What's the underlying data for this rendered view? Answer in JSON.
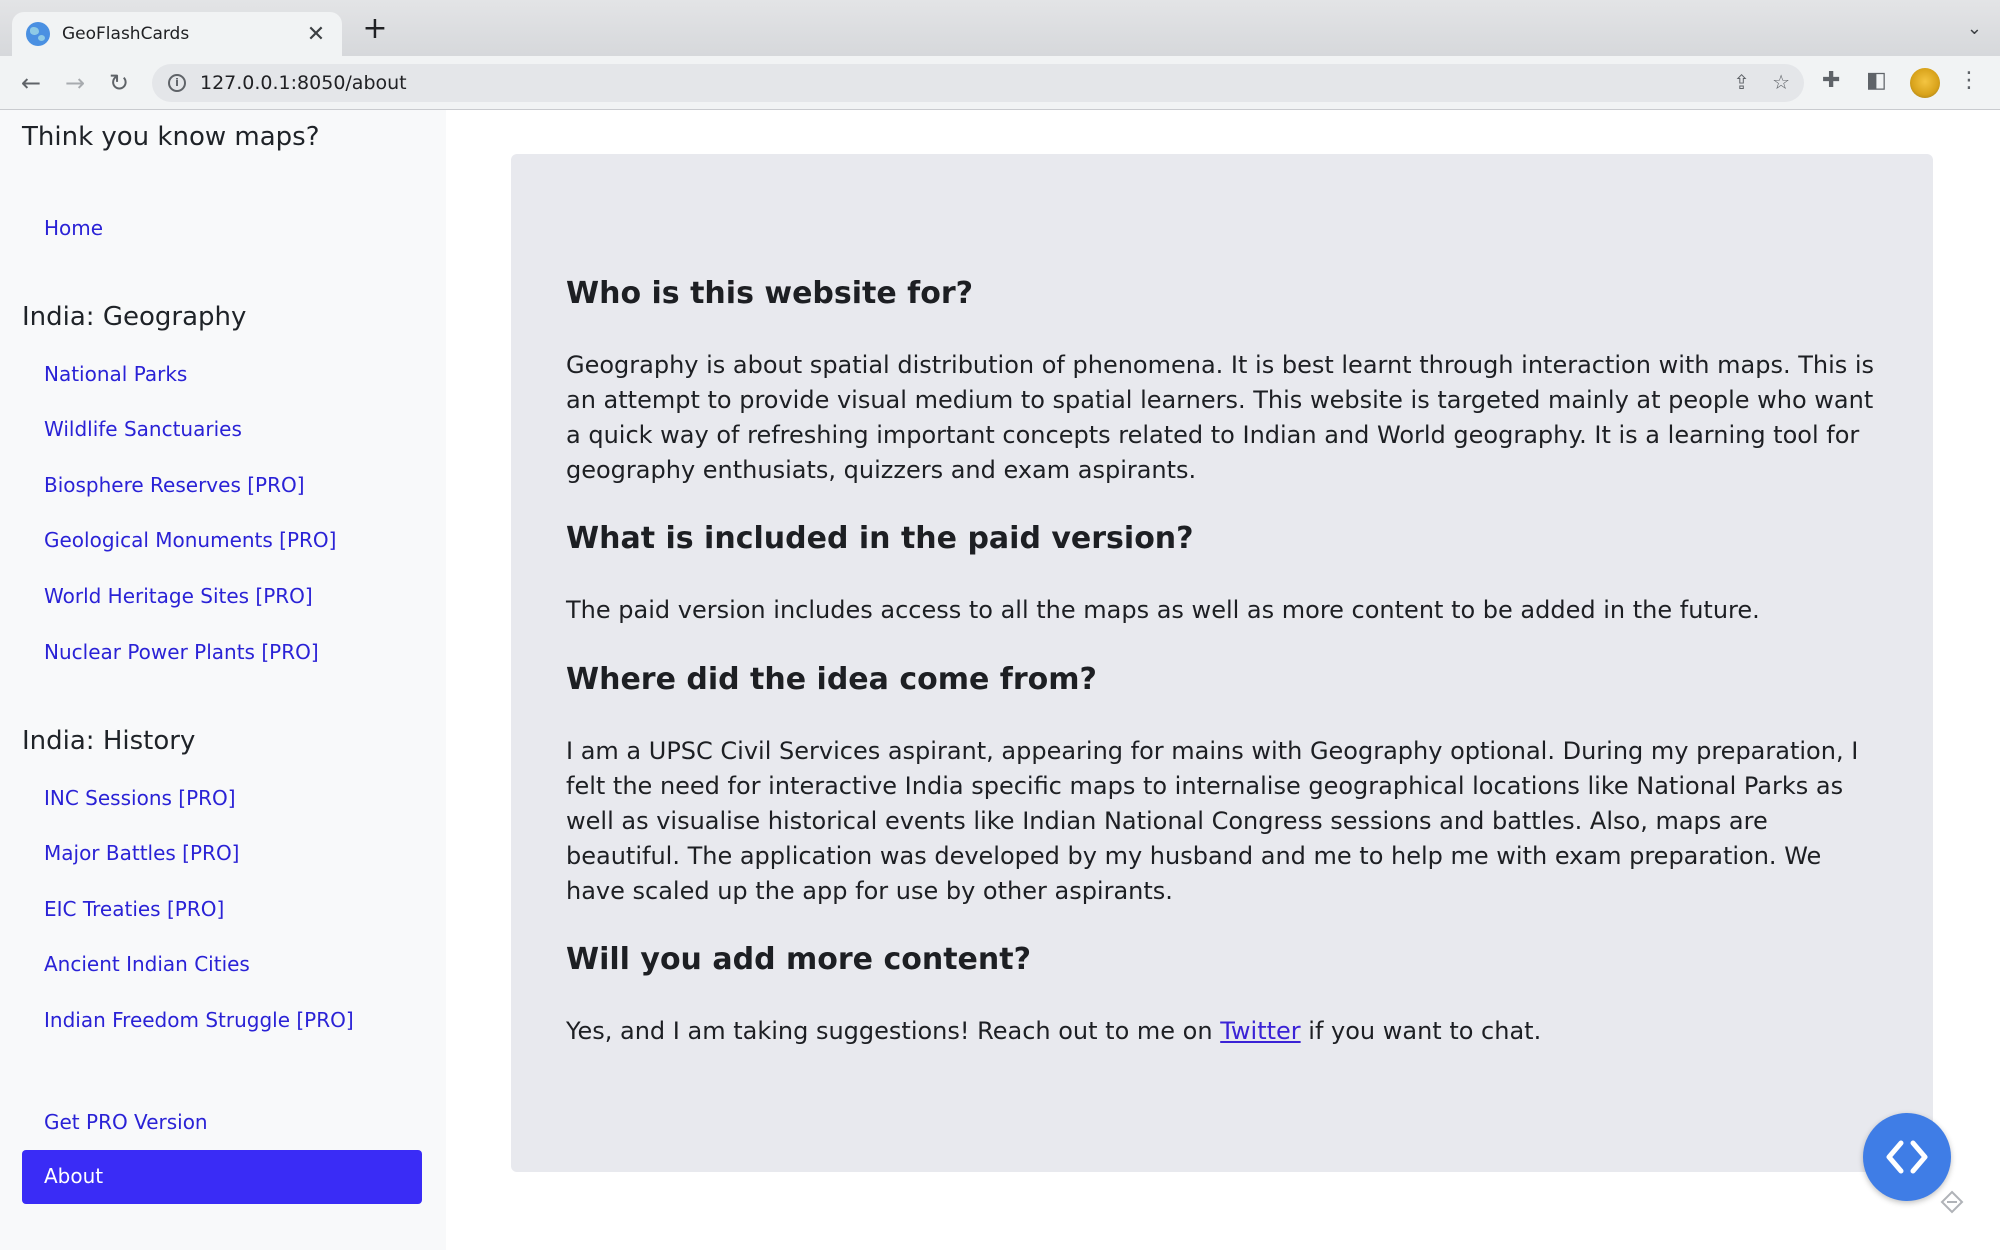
{
  "browser": {
    "tab_title": "GeoFlashCards",
    "url": "127.0.0.1:8050/about"
  },
  "sidebar": {
    "title": "Think you know maps?",
    "home": "Home",
    "sections": [
      {
        "heading": "India: Geography",
        "items": [
          "National Parks",
          "Wildlife Sanctuaries",
          "Biosphere Reserves [PRO]",
          "Geological Monuments [PRO]",
          "World Heritage Sites [PRO]",
          "Nuclear Power Plants [PRO]"
        ]
      },
      {
        "heading": "India: History",
        "items": [
          "INC Sessions [PRO]",
          "Major Battles [PRO]",
          "EIC Treaties [PRO]",
          "Ancient Indian Cities",
          "Indian Freedom Struggle [PRO]"
        ]
      }
    ],
    "pro": "Get PRO Version",
    "about": "About"
  },
  "about": {
    "q1": "Who is this website for?",
    "a1": "Geography is about spatial distribution of phenomena. It is best learnt through interaction with maps. This is an attempt to provide visual medium to spatial learners. This website is targeted mainly at people who want a quick way of refreshing important concepts related to Indian and World geography. It is a learning tool for geography enthusiats, quizzers and exam aspirants.",
    "q2": "What is included in the paid version?",
    "a2": "The paid version includes access to all the maps as well as more content to be added in the future.",
    "q3": "Where did the idea come from?",
    "a3": "I am a UPSC Civil Services aspirant, appearing for mains with Geography optional. During my preparation, I felt the need for interactive India specific maps to internalise geographical locations like National Parks as well as visualise historical events like Indian National Congress sessions and battles. Also, maps are beautiful. The application was developed by my husband and me to help me with exam preparation. We have scaled up the app for use by other aspirants.",
    "q4": "Will you add more content?",
    "a4_before": "Yes, and I am taking suggestions! Reach out to me on ",
    "a4_link": "Twitter",
    "a4_after": " if you want to chat."
  },
  "icons": {
    "favicon": "globe-icon",
    "fab": "code-brackets-icon"
  },
  "colors": {
    "link": "#2a22d6",
    "active_nav": "#3a2cf6",
    "fab": "#3f7de6",
    "card_bg": "#e8e9ee",
    "sidebar_bg": "#f8f9fa"
  }
}
